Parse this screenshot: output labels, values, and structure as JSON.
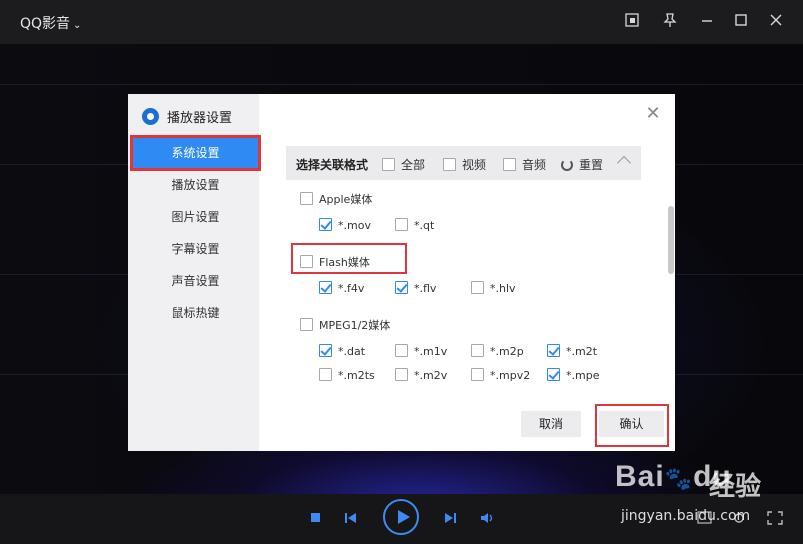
{
  "player": {
    "title": "QQ影音",
    "title_chevron": "⌄",
    "window_icons": [
      "screenshot-icon",
      "pin-icon",
      "minimize-icon",
      "maximize-icon",
      "close-icon"
    ]
  },
  "dialog": {
    "title": "播放器设置",
    "close_glyph": "✕",
    "nav": [
      {
        "label": "系统设置",
        "active": true
      },
      {
        "label": "播放设置",
        "active": false
      },
      {
        "label": "图片设置",
        "active": false
      },
      {
        "label": "字幕设置",
        "active": false
      },
      {
        "label": "声音设置",
        "active": false
      },
      {
        "label": "鼠标热键",
        "active": false
      }
    ],
    "header": {
      "title": "选择关联格式",
      "all": "全部",
      "video": "视频",
      "audio": "音频",
      "reset": "重置"
    },
    "groups": [
      {
        "label": "Apple媒体",
        "checked": false,
        "formats": [
          {
            "name": "*.mov",
            "checked": true
          },
          {
            "name": "*.qt",
            "checked": false
          }
        ]
      },
      {
        "label": "Flash媒体",
        "checked": false,
        "formats": [
          {
            "name": "*.f4v",
            "checked": true
          },
          {
            "name": "*.flv",
            "checked": true
          },
          {
            "name": "*.hlv",
            "checked": false
          }
        ]
      },
      {
        "label": "MPEG1/2媒体",
        "checked": false,
        "formats": [
          {
            "name": "*.dat",
            "checked": true
          },
          {
            "name": "*.m1v",
            "checked": false
          },
          {
            "name": "*.m2p",
            "checked": false
          },
          {
            "name": "*.m2t",
            "checked": true
          },
          {
            "name": "*.m2ts",
            "checked": false
          },
          {
            "name": "*.m2v",
            "checked": false
          },
          {
            "name": "*.mpv2",
            "checked": false
          },
          {
            "name": "*.mpe",
            "checked": true
          }
        ]
      }
    ],
    "cancel_label": "取消",
    "ok_label": "确认"
  },
  "watermark": {
    "logo": "Bai",
    "logo_paw": "🐾",
    "logo_suffix": "du",
    "text": "经验",
    "url": "jingyan.baidu.com"
  },
  "colors": {
    "accent": "#2f8bf3",
    "highlight": "#e0353a",
    "control": "#3d8bf2"
  }
}
